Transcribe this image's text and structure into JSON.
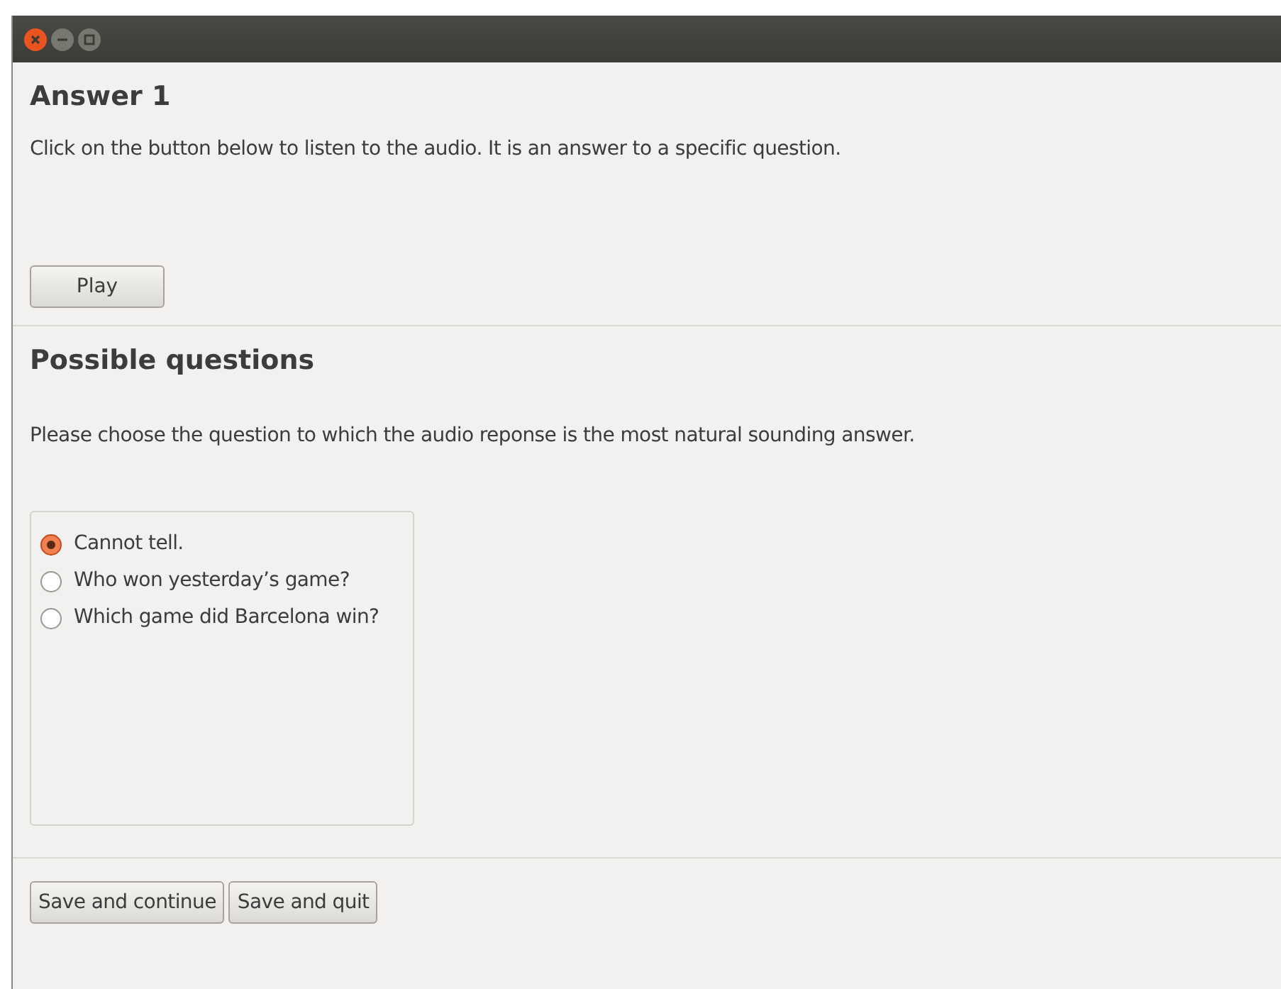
{
  "answer": {
    "title": "Answer 1",
    "instruction": "Click on the button below to listen to the audio. It is an answer to a specific question.",
    "play_button": "Play"
  },
  "questions": {
    "title": "Possible questions",
    "instruction": "Please choose the question to which the audio reponse is the most natural sounding answer.",
    "options": [
      {
        "label": "Cannot tell.",
        "selected": true
      },
      {
        "label": "Who won yesterday’s game?",
        "selected": false
      },
      {
        "label": "Which game did Barcelona win?",
        "selected": false
      }
    ]
  },
  "buttons": [
    "Save and continue",
    "Save and quit"
  ]
}
